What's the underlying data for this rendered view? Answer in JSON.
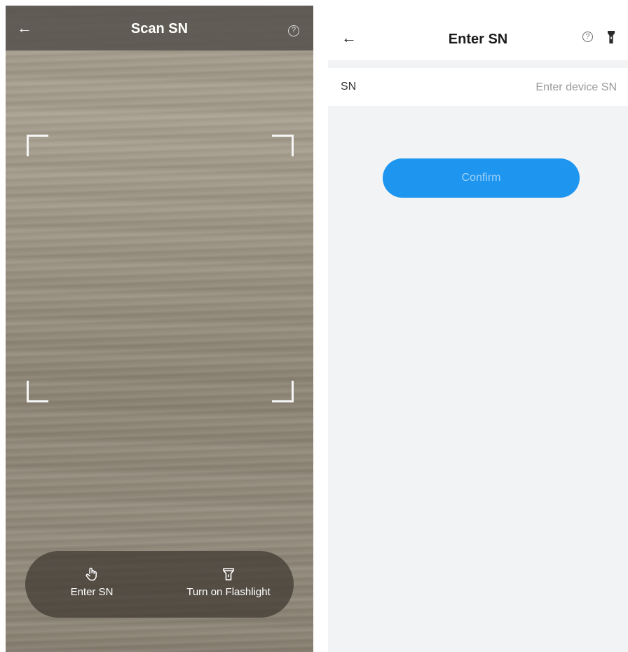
{
  "scan_screen": {
    "title": "Scan SN",
    "back_icon": "arrow-left-icon",
    "help_icon": "help-circle-icon",
    "help_glyph": "?",
    "actions": [
      {
        "label": "Enter SN",
        "icon": "hand-tap-icon"
      },
      {
        "label": "Turn on Flashlight",
        "icon": "flashlight-icon"
      }
    ]
  },
  "enter_screen": {
    "title": "Enter SN",
    "back_icon": "arrow-left-icon",
    "help_icon": "help-circle-icon",
    "help_glyph": "?",
    "flashlight_icon": "flashlight-icon",
    "field": {
      "label": "SN",
      "value": "",
      "placeholder": "Enter device SN"
    },
    "confirm_label": "Confirm"
  },
  "colors": {
    "accent": "#1e96f0",
    "confirm_text_disabled": "#9fd0f8",
    "page_background": "#f2f3f5"
  }
}
